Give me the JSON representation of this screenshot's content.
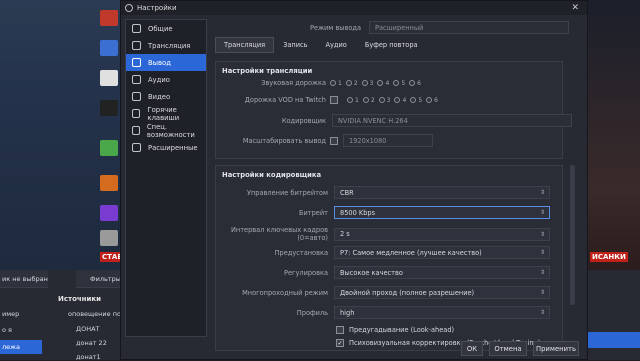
{
  "window": {
    "title": "Настройки"
  },
  "sidebar": {
    "items": [
      {
        "label": "Общие"
      },
      {
        "label": "Трансляция"
      },
      {
        "label": "Вывод"
      },
      {
        "label": "Аудио"
      },
      {
        "label": "Видео"
      },
      {
        "label": "Горячие клавиши"
      },
      {
        "label": "Спец. возможности"
      },
      {
        "label": "Расширенные"
      }
    ]
  },
  "output_mode": {
    "label": "Режим вывода",
    "value": "Расширенный"
  },
  "tabs": [
    {
      "label": "Трансляция"
    },
    {
      "label": "Запись"
    },
    {
      "label": "Аудио"
    },
    {
      "label": "Буфер повтора"
    }
  ],
  "stream_settings": {
    "title": "Настройки трансляции",
    "audio_track_label": "Звуковая дорожка",
    "vod_track_label": "Дорожка VOD на Twitch",
    "track_numbers": [
      "1",
      "2",
      "3",
      "4",
      "5",
      "6"
    ],
    "encoder_label": "Кодировщик",
    "encoder_value": "NVIDIA NVENC H.264",
    "rescale_label": "Масштабировать вывод",
    "rescale_value": "1920x1080"
  },
  "encoder_settings": {
    "title": "Настройки кодировщика",
    "rate_control_label": "Управление битрейтом",
    "rate_control_value": "CBR",
    "bitrate_label": "Битрейт",
    "bitrate_value": "8500 Kbps",
    "keyframe_label": "Интервал ключевых кадров (0=авто)",
    "keyframe_value": "2 s",
    "preset_label": "Предустановка",
    "preset_value": "P7: Самое медленное (лучшее качество)",
    "tuning_label": "Регулировка",
    "tuning_value": "Высокое качество",
    "multipass_label": "Многопроходный режим",
    "multipass_value": "Двойной проход (полное разрешение)",
    "profile_label": "Профиль",
    "profile_value": "high",
    "lookahead_label": "Предугадывание (Look-ahead)",
    "psycho_label": "Психовизуальная корректировка (Psycho Visual Tuning)"
  },
  "buttons": {
    "ok": "ОК",
    "cancel": "Отмена",
    "apply": "Применить"
  },
  "obs": {
    "scene_bar_text": "ик не выбран",
    "filters_label": "Фильтры",
    "sources_title": "Источники",
    "scenes": [
      "имер",
      "о я",
      "лежа"
    ],
    "sources": [
      "оповещение по",
      "ДОНАТ",
      "донат 22",
      "донат1"
    ]
  },
  "desktop": {
    "banner_left": "СТАВ",
    "banner_right": "ИСАНКИ"
  }
}
